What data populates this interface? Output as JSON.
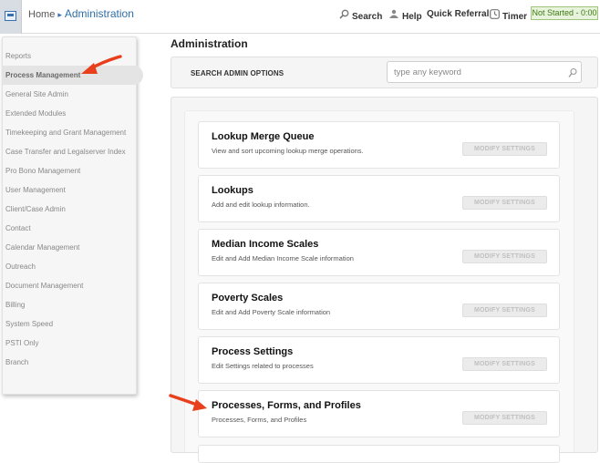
{
  "header": {
    "breadcrumb_home": "Home",
    "breadcrumb_sep": "▸",
    "breadcrumb_current": "Administration",
    "search_label": "Search",
    "help_label": "Help",
    "quick_referral_label": "Quick Referral",
    "timer_label": "Timer",
    "status": "Not Started - 0:00"
  },
  "sidebar": {
    "items": [
      {
        "label": "Reports"
      },
      {
        "label": "Process Management",
        "active": true
      },
      {
        "label": "General Site Admin"
      },
      {
        "label": "Extended Modules"
      },
      {
        "label": "Timekeeping and Grant Management"
      },
      {
        "label": "Case Transfer and Legalserver Index"
      },
      {
        "label": "Pro Bono Management"
      },
      {
        "label": "User Management"
      },
      {
        "label": "Client/Case Admin"
      },
      {
        "label": "Contact"
      },
      {
        "label": "Calendar Management"
      },
      {
        "label": "Outreach"
      },
      {
        "label": "Document Management"
      },
      {
        "label": "Billing"
      },
      {
        "label": "System Speed"
      },
      {
        "label": "PSTI Only"
      },
      {
        "label": "Branch"
      }
    ]
  },
  "main": {
    "title": "Administration",
    "search": {
      "label": "SEARCH ADMIN OPTIONS",
      "placeholder": "type any keyword"
    },
    "cards": [
      {
        "title": "Lookup Merge Queue",
        "desc": "View and sort upcoming lookup merge operations.",
        "button": "MODIFY SETTINGS"
      },
      {
        "title": "Lookups",
        "desc": "Add and edit lookup information.",
        "button": "MODIFY SETTINGS"
      },
      {
        "title": "Median Income Scales",
        "desc": "Edit and Add Median Income Scale information",
        "button": "MODIFY SETTINGS"
      },
      {
        "title": "Poverty Scales",
        "desc": "Edit and Add Poverty Scale information",
        "button": "MODIFY SETTINGS"
      },
      {
        "title": "Process Settings",
        "desc": "Edit Settings related to processes",
        "button": "MODIFY SETTINGS"
      },
      {
        "title": "Processes, Forms, and Profiles",
        "desc": "Processes, Forms, and Profiles",
        "button": "MODIFY SETTINGS"
      }
    ]
  },
  "colors": {
    "accent": "#2f6ea7",
    "status_green": "#3f7a12",
    "annotation_arrow": "#e8401c"
  },
  "icons": {
    "search": "magnifier-icon",
    "help": "help-person-icon",
    "timer": "clock-icon"
  }
}
